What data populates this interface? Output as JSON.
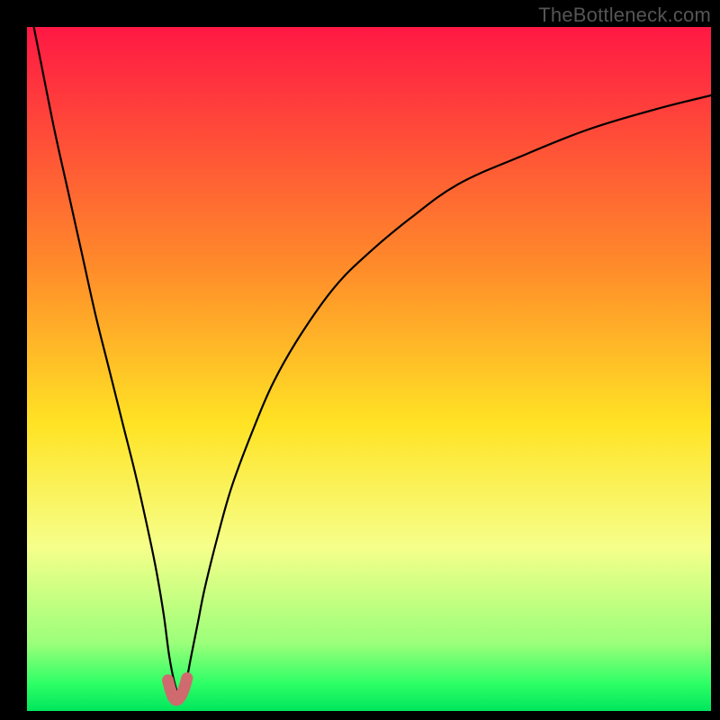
{
  "watermark": "TheBottleneck.com",
  "colors": {
    "frame": "#000000",
    "curve": "#000000",
    "highlight": "#cf6a6f",
    "gradient_top": "#ff1844",
    "gradient_mid_upper": "#ff8b2a",
    "gradient_mid": "#ffe324",
    "gradient_mid_lower": "#f6ff8a",
    "gradient_green1": "#9cff7a",
    "gradient_green2": "#2eff66",
    "gradient_bottom": "#00e65c"
  },
  "chart_data": {
    "type": "line",
    "title": "",
    "xlabel": "",
    "ylabel": "",
    "xlim": [
      0,
      100
    ],
    "ylim": [
      0,
      100
    ],
    "grid": false,
    "annotations": [
      "TheBottleneck.com"
    ],
    "series": [
      {
        "name": "bottleneck-curve",
        "x": [
          1,
          2,
          4,
          6,
          8,
          10,
          12,
          14,
          16,
          18,
          19,
          20,
          20.8,
          21.6,
          22.4,
          23.2,
          24,
          25,
          26,
          28,
          30,
          33,
          36,
          40,
          45,
          50,
          56,
          63,
          72,
          82,
          92,
          100
        ],
        "y": [
          100,
          95,
          85,
          76,
          67,
          58,
          50,
          42,
          34,
          25,
          20,
          14,
          8,
          4,
          2,
          4,
          8,
          13,
          18,
          26,
          33,
          41,
          48,
          55,
          62,
          67,
          72,
          77,
          81,
          85,
          88,
          90
        ]
      },
      {
        "name": "optimal-highlight",
        "x": [
          20.6,
          21.0,
          21.4,
          21.8,
          22.2,
          22.6,
          23.0,
          23.4
        ],
        "y": [
          4.5,
          3.0,
          2.0,
          1.6,
          1.8,
          2.4,
          3.4,
          4.8
        ]
      }
    ]
  }
}
